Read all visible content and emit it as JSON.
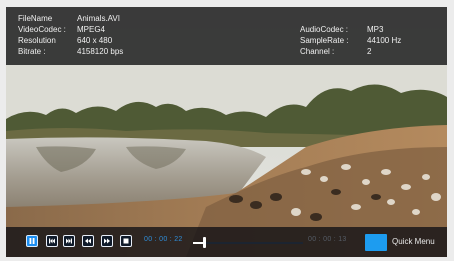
{
  "info": {
    "left": [
      {
        "key": "FileName",
        "value": "Animals.AVI"
      },
      {
        "key": "VideoCodec :",
        "value": "MPEG4"
      },
      {
        "key": "Resolution",
        "value": "640 x 480"
      },
      {
        "key": "Bitrate :",
        "value": "4158120 bps"
      }
    ],
    "right": [
      {
        "key": "AudioCodec :",
        "value": "MP3"
      },
      {
        "key": "SampleRate :",
        "value": "44100 Hz"
      },
      {
        "key": "Channel :",
        "value": "2"
      }
    ]
  },
  "controls": {
    "elapsed": "00 : 00 : 22",
    "remaining": "00 : 00 : 13",
    "progress_fraction": 0.1,
    "quick_menu_label": "Quick Menu",
    "icons": [
      "pause-icon",
      "skip-previous-icon",
      "skip-next-icon",
      "rewind-icon",
      "fast-forward-icon",
      "stop-icon"
    ]
  },
  "colors": {
    "accent": "#1d9cf0",
    "time_elapsed": "#2f8dd8",
    "time_remaining": "#555c66"
  }
}
